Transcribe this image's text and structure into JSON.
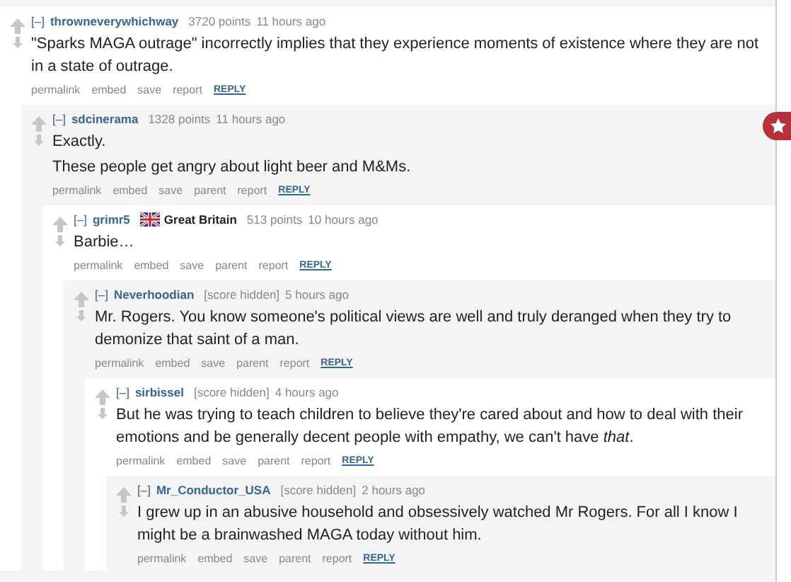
{
  "comments": [
    {
      "toggle": "[–]",
      "author": "throwneverywhichway",
      "score": "3720 points",
      "time": "11 hours ago",
      "body": [
        "\"Sparks MAGA outrage\" incorrectly implies that they experience moments of existence where they are not in a state of outrage."
      ],
      "actions": [
        "permalink",
        "embed",
        "save",
        "report"
      ],
      "reply": "REPLY",
      "children": [
        {
          "toggle": "[–]",
          "author": "sdcinerama",
          "score": "1328 points",
          "time": "11 hours ago",
          "body": [
            "Exactly.",
            "These people get angry about light beer and M&Ms."
          ],
          "actions": [
            "permalink",
            "embed",
            "save",
            "parent",
            "report"
          ],
          "reply": "REPLY",
          "children": [
            {
              "toggle": "[–]",
              "author": "grimr5",
              "flair": {
                "label": "Great Britain"
              },
              "score": "513 points",
              "time": "10 hours ago",
              "body": [
                "Barbie…"
              ],
              "actions": [
                "permalink",
                "embed",
                "save",
                "parent",
                "report"
              ],
              "reply": "REPLY",
              "children": [
                {
                  "toggle": "[–]",
                  "author": "Neverhoodian",
                  "score": "[score hidden]",
                  "time": "5 hours ago",
                  "body": [
                    "Mr. Rogers. You know someone's political views are well and truly deranged when they try to demonize that saint of a man."
                  ],
                  "actions": [
                    "permalink",
                    "embed",
                    "save",
                    "parent",
                    "report"
                  ],
                  "reply": "REPLY",
                  "children": [
                    {
                      "toggle": "[–]",
                      "author": "sirbissel",
                      "score": "[score hidden]",
                      "time": "4 hours ago",
                      "body": [
                        "But he was trying to teach children to believe they're cared about and how to deal with their emotions and be generally decent people with empathy, we can't have *that*."
                      ],
                      "actions": [
                        "permalink",
                        "embed",
                        "save",
                        "parent",
                        "report"
                      ],
                      "reply": "REPLY",
                      "children": [
                        {
                          "toggle": "[–]",
                          "author": "Mr_Conductor_USA",
                          "score": "[score hidden]",
                          "time": "2 hours ago",
                          "body": [
                            "I grew up in an abusive household and obsessively watched Mr Rogers. For all I know I might be a brainwashed MAGA today without him."
                          ],
                          "actions": [
                            "permalink",
                            "embed",
                            "save",
                            "parent",
                            "report"
                          ],
                          "reply": "REPLY"
                        }
                      ]
                    }
                  ]
                }
              ]
            }
          ]
        }
      ]
    }
  ]
}
